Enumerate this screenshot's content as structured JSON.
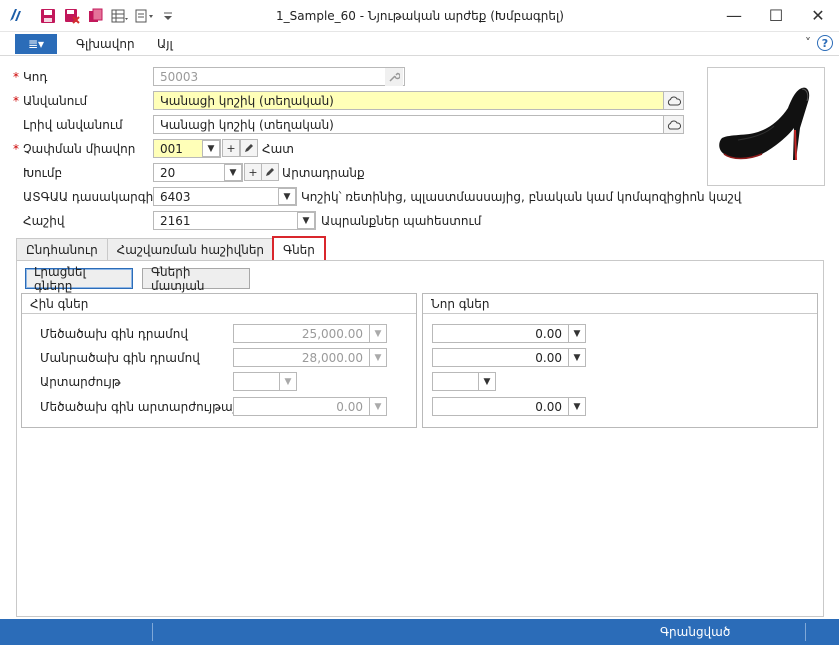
{
  "window": {
    "title": "1_Sample_60 - Նյութական արժեք (Խմբագրել)",
    "minimize": "—",
    "maximize": "☐",
    "close": "✕"
  },
  "quick_access": {
    "icons": [
      "app-logo-icon",
      "save-icon",
      "save-close-icon",
      "copy-icon",
      "table-view-icon",
      "print-icon",
      "customize-icon"
    ]
  },
  "ribbon": {
    "menu_icon": "≣▾",
    "tabs": [
      "Գլխավոր",
      "Այլ"
    ],
    "collapse_icon": "˅",
    "help": "?"
  },
  "form": {
    "code": {
      "label": "Կոդ",
      "value": "50003",
      "required": true
    },
    "name": {
      "label": "Անվանում",
      "value": "Կանացի կոշիկ (տեղական)",
      "required": true
    },
    "full_name": {
      "label": "Լրիվ անվանում",
      "value": "Կանացի կոշիկ (տեղական)"
    },
    "unit": {
      "label": "Չափման միավոր",
      "value": "001",
      "description": "Հատ",
      "required": true
    },
    "group": {
      "label": "Խումբ",
      "value": "20",
      "description": "Արտադրանք"
    },
    "classifier": {
      "label": "ԱՏԳԱԱ դասակարգիչ",
      "value": "6403",
      "description": "Կոշիկ՝ ռետինից, պլաստմասսայից, բնական կամ կոմպոզիցիոն կաշվ"
    },
    "account": {
      "label": "Հաշիվ",
      "value": "2161",
      "description": "Ապրանքներ պահեստում"
    }
  },
  "tabs": [
    {
      "label": "Ընդհանուր"
    },
    {
      "label": "Հաշվառման հաշիվներ"
    },
    {
      "label": "Գներ",
      "active": true
    }
  ],
  "prices_tab": {
    "fill_button": "Լրացնել գները",
    "history_button": "Գների մատյան",
    "old_prices": {
      "title": "Հին գներ",
      "rows": [
        {
          "label": "Մեծածախ գին դրամով",
          "value": "25,000.00"
        },
        {
          "label": "Մանրածախ գին դրամով",
          "value": "28,000.00"
        },
        {
          "label": "Արտարժույթ",
          "value": ""
        },
        {
          "label": "Մեծածախ գին արտարժույթային",
          "value": "0.00"
        }
      ]
    },
    "new_prices": {
      "title": "Նոր գներ",
      "rows": [
        {
          "value": "0.00"
        },
        {
          "value": "0.00"
        },
        {
          "value": ""
        },
        {
          "value": "0.00"
        }
      ]
    }
  },
  "status": {
    "text": "Գրանցված"
  },
  "colors": {
    "accent": "#2b6cb8",
    "required": "#cc0000",
    "highlight": "#ffffb8",
    "active_tab_outline": "#d9262c"
  }
}
